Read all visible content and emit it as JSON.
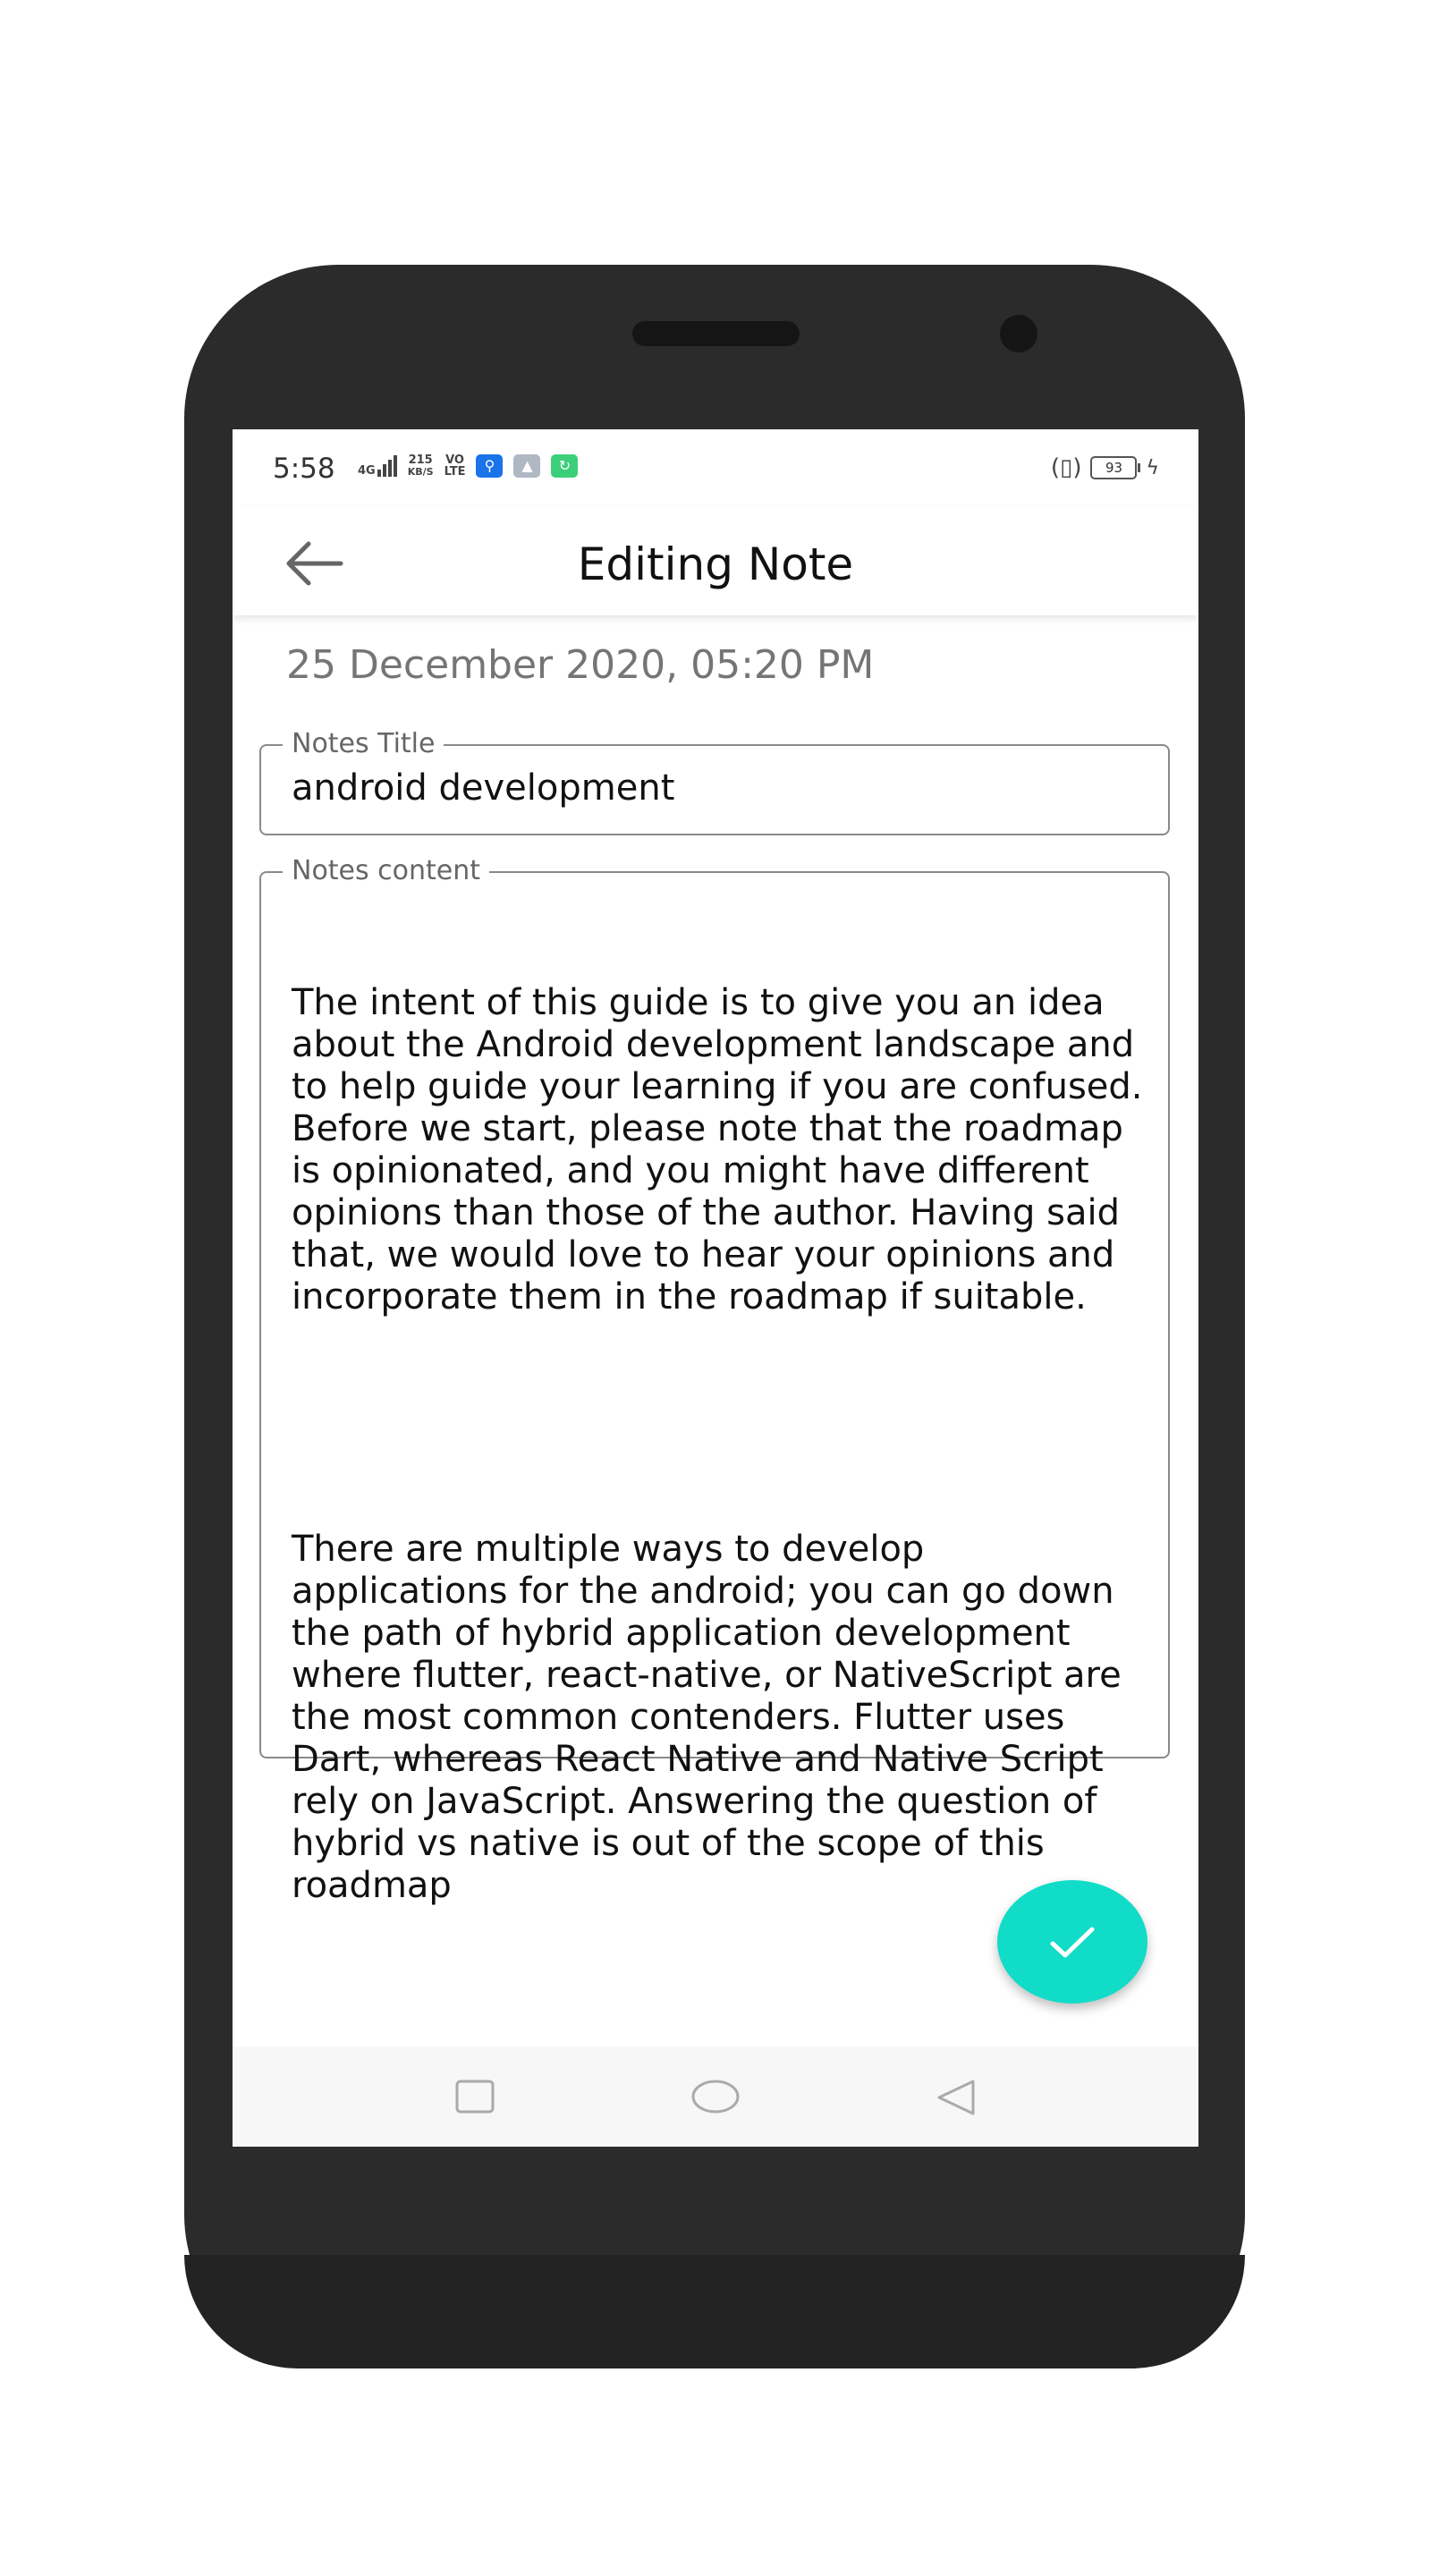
{
  "status_bar": {
    "time": "5:58",
    "network": "4G",
    "speed_value": "215",
    "speed_unit": "KB/S",
    "volte_top": "VO",
    "volte_bottom": "LTE",
    "battery": "93"
  },
  "app_bar": {
    "title": "Editing Note",
    "back_icon": "arrow-left-icon"
  },
  "note": {
    "date": "25 December 2020, 05:20 PM",
    "title_label": "Notes Title",
    "title_value": "android development",
    "content_label": "Notes content",
    "content_paragraph_1": "The intent of this guide is to give you an idea about the Android development landscape and to help guide your learning if you are confused. Before we start, please note that the roadmap is opinionated, and you might have different opinions than those of the author. Having said that, we would love to hear your opinions and incorporate them in the roadmap if suitable.",
    "content_paragraph_2": "There are multiple ways to develop applications for the android; you can go down the path of hybrid application development where flutter, react-native, or NativeScript are the most common contenders. Flutter uses Dart, whereas React Native and Native Script rely on JavaScript. Answering the question of hybrid vs native is out of the scope of this roadmap"
  },
  "fab": {
    "icon": "check-icon",
    "color": "#11dcc8"
  },
  "nav_bar": {
    "recents_icon": "square-icon",
    "home_icon": "circle-icon",
    "back_icon": "triangle-back-icon"
  }
}
